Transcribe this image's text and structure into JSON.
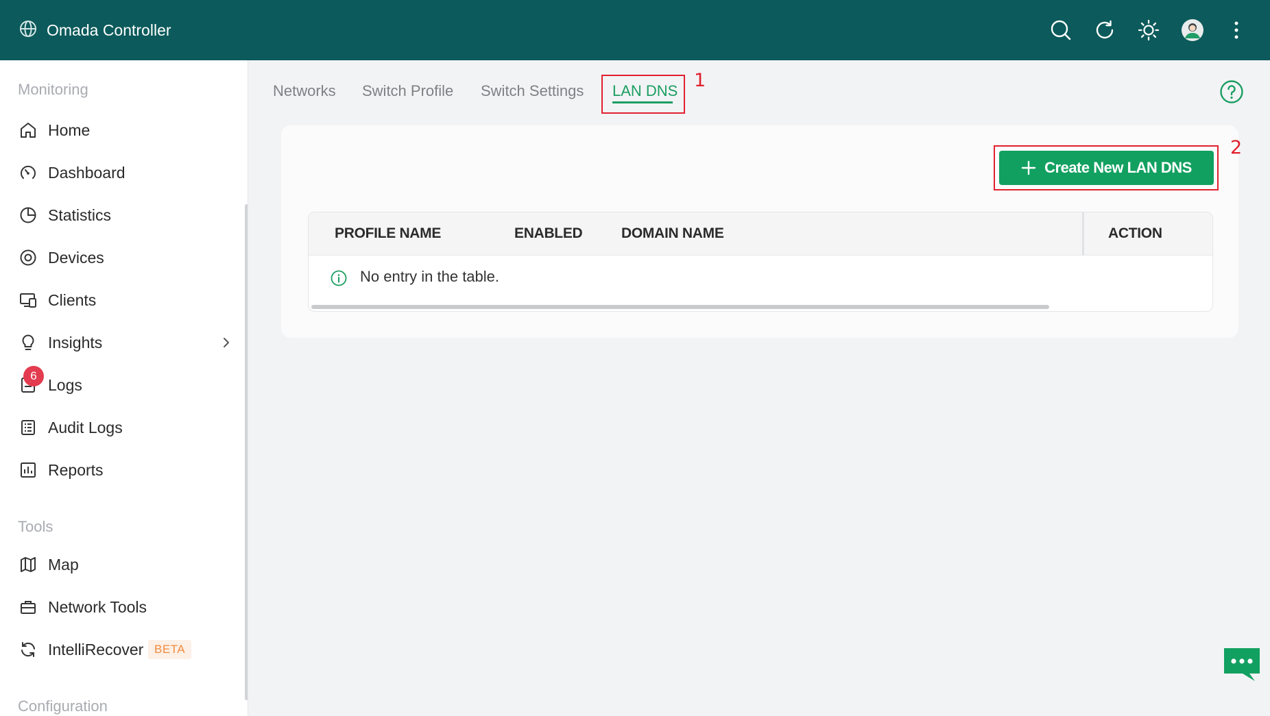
{
  "header": {
    "brand_title": "Omada Controller",
    "icons": [
      "search-icon",
      "refresh-icon",
      "theme-sun-icon",
      "user-avatar-icon",
      "more-vertical-icon"
    ]
  },
  "sidebar": {
    "sections": [
      {
        "title": "Monitoring",
        "items": [
          {
            "label": "Home",
            "icon": "home-icon"
          },
          {
            "label": "Dashboard",
            "icon": "dashboard-gauge-icon"
          },
          {
            "label": "Statistics",
            "icon": "pie-chart-icon"
          },
          {
            "label": "Devices",
            "icon": "device-target-icon"
          },
          {
            "label": "Clients",
            "icon": "clients-monitor-icon"
          },
          {
            "label": "Insights",
            "icon": "lightbulb-icon",
            "has_submenu": true
          },
          {
            "label": "Logs",
            "icon": "logs-document-icon",
            "badge": "6"
          },
          {
            "label": "Audit Logs",
            "icon": "audit-list-icon"
          },
          {
            "label": "Reports",
            "icon": "bar-chart-icon"
          }
        ]
      },
      {
        "title": "Tools",
        "items": [
          {
            "label": "Map",
            "icon": "map-icon"
          },
          {
            "label": "Network Tools",
            "icon": "toolbox-icon"
          },
          {
            "label": "IntelliRecover",
            "icon": "recover-cycle-icon",
            "tag": "BETA"
          }
        ]
      },
      {
        "title": "Configuration",
        "items": []
      }
    ]
  },
  "tabs": {
    "items": [
      {
        "label": "Networks",
        "active": false
      },
      {
        "label": "Switch Profile",
        "active": false
      },
      {
        "label": "Switch Settings",
        "active": false
      },
      {
        "label": "LAN DNS",
        "active": true
      }
    ]
  },
  "annotations": [
    "1",
    "2"
  ],
  "content": {
    "create_button_label": "Create New LAN DNS",
    "table": {
      "columns": [
        "PROFILE NAME",
        "ENABLED",
        "DOMAIN NAME",
        "ACTION"
      ],
      "empty_message": "No entry in the table."
    }
  },
  "colors": {
    "header_bg": "#0c5a5b",
    "accent_green": "#12a060",
    "annotation_red": "#e0202e",
    "badge_red": "#e33b4f"
  }
}
